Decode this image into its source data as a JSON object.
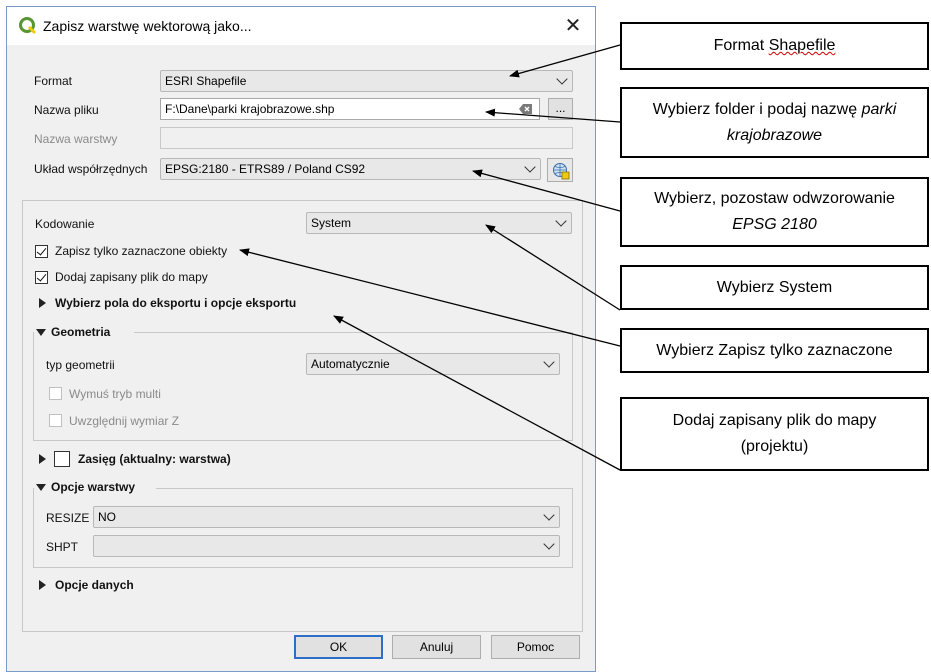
{
  "dialog": {
    "title": "Zapisz warstwę wektorową jako...",
    "close_symbol": "✕",
    "format_label": "Format",
    "format_value": "ESRI Shapefile",
    "filename_label": "Nazwa pliku",
    "filename_value": "F:\\Dane\\parki krajobrazowe.shp",
    "browse_label": "...",
    "layername_label": "Nazwa warstwy",
    "layername_value": "",
    "crs_label": "Układ współrzędnych",
    "crs_value": "EPSG:2180 - ETRS89 / Poland CS92",
    "encoding_label": "Kodowanie",
    "encoding_value": "System",
    "save_selected_label": "Zapisz tylko zaznaczone obiekty",
    "save_selected_checked": true,
    "add_to_map_label": "Dodaj zapisany plik do mapy",
    "add_to_map_checked": true,
    "fields_export_label": "Wybierz pola do eksportu i opcje eksportu",
    "geometry_label": "Geometria",
    "geometry_type_label": "typ geometrii",
    "geometry_type_value": "Automatycznie",
    "force_multi_label": "Wymuś tryb multi",
    "include_z_label": "Uwzględnij wymiar Z",
    "extent_label": "Zasięg (aktualny: warstwa)",
    "layer_options_label": "Opcje warstwy",
    "resize_label": "RESIZE",
    "resize_value": "NO",
    "shpt_label": "SHPT",
    "shpt_value": "",
    "data_options_label": "Opcje danych",
    "ok_label": "OK",
    "cancel_label": "Anuluj",
    "help_label": "Pomoc"
  },
  "callouts": {
    "format_prefix": "Format ",
    "format_word": "Shapefile",
    "folder_line1_prefix": "Wybierz folder i podaj nazwę ",
    "folder_line1_italic": "parki",
    "folder_line2_italic": "krajobrazowe",
    "crs_line1": "Wybierz, pozostaw odwzorowanie",
    "crs_line2_italic": "EPSG 2180",
    "system": "Wybierz System",
    "selected": "Wybierz Zapisz tylko zaznaczone",
    "addmap_line1": "Dodaj zapisany plik do mapy",
    "addmap_line2": "(projektu)"
  },
  "colors": {
    "dialog_border": "#7a9bc8",
    "qgis_green": "#589632",
    "qgis_yellow": "#eec90d",
    "default_button_border": "#2b6fc8",
    "spellcheck_underline": "#d00000"
  },
  "icons": {
    "title": "qgis-logo-icon",
    "clear": "clear-input-icon",
    "crs": "crs-globe-icon"
  }
}
